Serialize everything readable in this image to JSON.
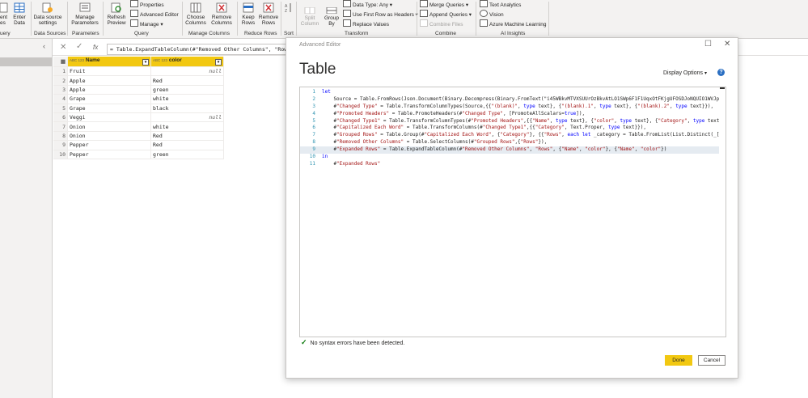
{
  "ribbon": {
    "groups": {
      "query_left": "uery",
      "data_sources": "Data Sources",
      "parameters": "Parameters",
      "query": "Query",
      "manage_columns": "Manage Columns",
      "reduce_rows": "Reduce Rows",
      "sort": "Sort",
      "transform": "Transform",
      "combine": "Combine",
      "ai_insights": "AI Insights"
    },
    "buttons": {
      "recent_line1": "ent",
      "recent_line2": "es",
      "enter_data_line1": "Enter",
      "enter_data_line2": "Data",
      "data_source_settings_line1": "Data source",
      "data_source_settings_line2": "settings",
      "manage_parameters_line1": "Manage",
      "manage_parameters_line2": "Parameters",
      "refresh_preview_line1": "Refresh",
      "refresh_preview_line2": "Preview",
      "properties": "Properties",
      "advanced_editor": "Advanced Editor",
      "manage": "Manage",
      "choose_columns_line1": "Choose",
      "choose_columns_line2": "Columns",
      "remove_columns_line1": "Remove",
      "remove_columns_line2": "Columns",
      "keep_rows_line1": "Keep",
      "keep_rows_line2": "Rows",
      "remove_rows_line1": "Remove",
      "remove_rows_line2": "Rows",
      "split_column_line1": "Split",
      "split_column_line2": "Column",
      "group_by_line1": "Group",
      "group_by_line2": "By",
      "data_type": "Data Type: Any",
      "use_first_row": "Use First Row as Headers",
      "replace_values": "Replace Values",
      "merge_queries": "Merge Queries",
      "append_queries": "Append Queries",
      "combine_files": "Combine Files",
      "text_analytics": "Text Analytics",
      "vision": "Vision",
      "azure_ml": "Azure Machine Learning"
    }
  },
  "formula_bar": {
    "fx": "fx",
    "formula": "= Table.ExpandTableColumn(#\"Removed Other Columns\", \"Rows\","
  },
  "grid": {
    "type_badge": "ABC 123",
    "columns": [
      "Name",
      "color"
    ],
    "rows": [
      {
        "n": "1",
        "name": "Fruit",
        "color": "null"
      },
      {
        "n": "2",
        "name": "Apple",
        "color": "Red"
      },
      {
        "n": "3",
        "name": "Apple",
        "color": "green"
      },
      {
        "n": "4",
        "name": "Grape",
        "color": "white"
      },
      {
        "n": "5",
        "name": "Grape",
        "color": "black"
      },
      {
        "n": "6",
        "name": "Veggi",
        "color": "null"
      },
      {
        "n": "7",
        "name": "Onion",
        "color": "white"
      },
      {
        "n": "8",
        "name": "Onion",
        "color": "Red"
      },
      {
        "n": "9",
        "name": "Pepper",
        "color": "Red"
      },
      {
        "n": "10",
        "name": "Pepper",
        "color": "green"
      }
    ]
  },
  "dialog": {
    "window_title": "Advanced Editor",
    "title": "Table",
    "display_options": "Display Options",
    "help": "?",
    "status": "No syntax errors have been detected.",
    "done": "Done",
    "cancel": "Cancel",
    "code_lines": [
      "let",
      "    Source = Table.FromRows(Json.Document(Binary.Decompress(Binary.FromText(\"i45WBkvMTVXSUUrOzBkvAtLO1SWp6F1F1UqxOtFKjgUFOSDJoNQUIO1WVJp",
      "    #\"Changed Type\" = Table.TransformColumnTypes(Source,{{\"(blank)\", type text}, {\"(blank).1\", type text}, {\"(blank).2\", type text}}),",
      "    #\"Promoted Headers\" = Table.PromoteHeaders(#\"Changed Type\", [PromoteAllScalars=true]),",
      "    #\"Changed Type1\" = Table.TransformColumnTypes(#\"Promoted Headers\",{{\"Name\", type text}, {\"color\", type text}, {\"Category\", type text",
      "    #\"Capitalized Each Word\" = Table.TransformColumns(#\"Changed Type1\",{{\"Category\", Text.Proper, type text}}),",
      "    #\"Grouped Rows\" = Table.Group(#\"Capitalized Each Word\", {\"Category\"}, {{\"Rows\", each let _category = Table.FromList(List.Distinct(_[",
      "    #\"Removed Other Columns\" = Table.SelectColumns(#\"Grouped Rows\",{\"Rows\"}),",
      "    #\"Expanded Rows\" = Table.ExpandTableColumn(#\"Removed Other Columns\", \"Rows\", {\"Name\", \"color\"}, {\"Name\", \"color\"})",
      "in",
      "    #\"Expanded Rows\""
    ]
  },
  "colors": {
    "accent": "#f2c811",
    "keyword": "#0000ff",
    "string": "#a31515",
    "line_number": "#2b91af"
  }
}
